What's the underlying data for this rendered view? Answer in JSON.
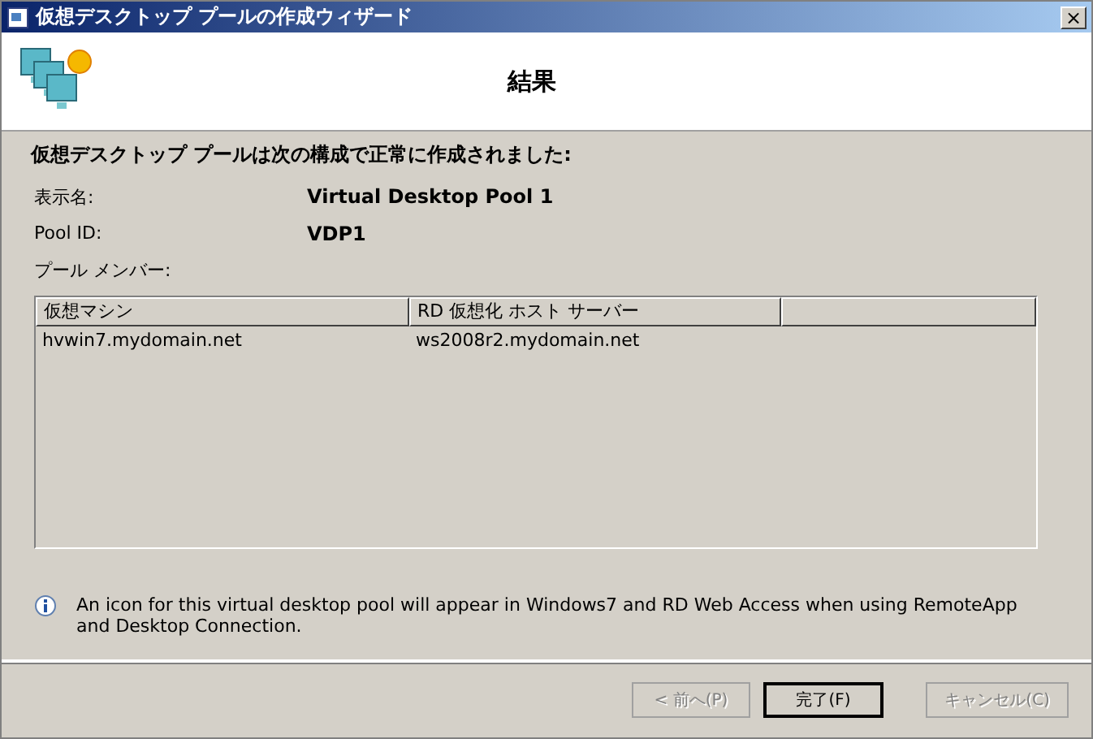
{
  "window": {
    "title": "仮想デスクトップ プールの作成ウィザード",
    "close": "×"
  },
  "header": {
    "title": "結果"
  },
  "summary": "仮想デスクトップ プールは次の構成で正常に作成されました:",
  "fields": [
    {
      "label": "表示名:",
      "value": "Virtual Desktop Pool 1"
    },
    {
      "label": "Pool ID:",
      "value": "VDP1"
    }
  ],
  "members_label": "プール メンバー:",
  "table": {
    "columns": [
      "仮想マシン",
      "RD 仮想化 ホスト サーバー"
    ],
    "rows": [
      [
        "hvwin7.mydomain.net",
        "ws2008r2.mydomain.net"
      ]
    ]
  },
  "info": "An icon for this virtual desktop pool will appear in Windows7 and RD Web Access when using RemoteApp and Desktop Connection.",
  "buttons": [
    {
      "label": "< 前へ(P)",
      "disabled": true,
      "default": false
    },
    {
      "label": "完了(F)",
      "disabled": false,
      "default": true
    },
    {
      "label": "キャンセル(C)",
      "disabled": true,
      "default": false
    }
  ]
}
